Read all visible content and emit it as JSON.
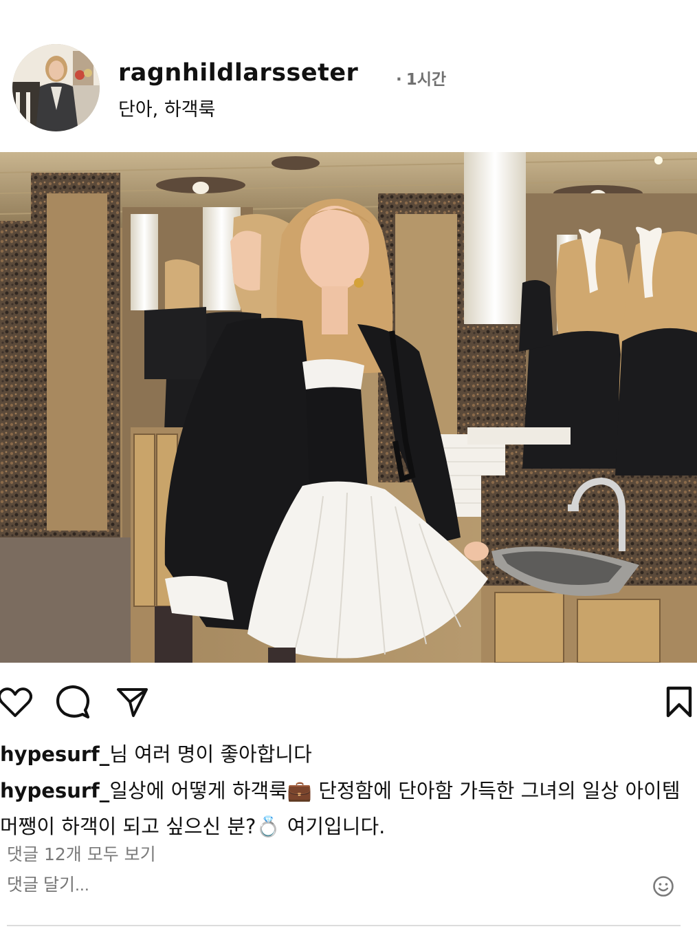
{
  "header": {
    "username": "ragnhildlarsseter",
    "time": "1시간",
    "time_separator": "·",
    "location": "단아, 하객룩"
  },
  "actions": {
    "like_icon": "heart-outline-icon",
    "comment_icon": "speech-bubble-icon",
    "share_icon": "paper-plane-icon",
    "save_icon": "bookmark-outline-icon"
  },
  "likes": {
    "user": "hypesurf_",
    "text": "님 여러 명이 좋아합니다"
  },
  "caption": {
    "user": "hypesurf_",
    "text": "일상에 어떻게 하객룩💼 단정함에 단아함 가득한 그녀의 일상 아이템 머쨍이 하객이 되고 싶으신 분?💍 여기입니다."
  },
  "comments": {
    "view_all": "댓글 12개 모두 보기",
    "add_placeholder": "댓글 달기...",
    "emoji_icon": "smiley-icon"
  },
  "colors": {
    "text": "#111111",
    "muted": "#7a7a7a",
    "divider": "#dcdcdc"
  }
}
